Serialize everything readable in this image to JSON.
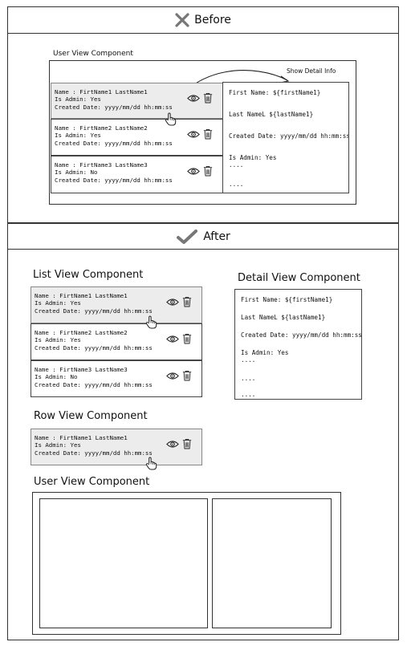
{
  "before": {
    "header": "Before",
    "user_view_label": "User View Component",
    "arrow_label": "Show Detail Info",
    "rows": [
      {
        "name": "Name : FirtName1 LastName1",
        "admin": "Is Admin: Yes",
        "created": "Created Date: yyyy/mm/dd hh:mm:ss"
      },
      {
        "name": "Name : FirtName2 LastName2",
        "admin": "Is Admin: Yes",
        "created": "Created Date: yyyy/mm/dd hh:mm:ss"
      },
      {
        "name": "Name : FirtName3 LastName3",
        "admin": "Is Admin: No",
        "created": "Created Date: yyyy/mm/dd hh:mm:ss"
      }
    ],
    "detail": {
      "first": "First Name: ${firstName1}",
      "last": "Last NameL ${lastName1}",
      "created": "Created Date: yyyy/mm/dd hh:mm:ss",
      "admin": "Is Admin: Yes",
      "e1": "....",
      "e2": "....",
      "e3": "...."
    }
  },
  "after": {
    "header": "After",
    "list_label": "List View Component",
    "detail_label": "Detail View Component",
    "row_label": "Row View Component",
    "user_view_label": "User View Component",
    "rows": [
      {
        "name": "Name : FirtName1 LastName1",
        "admin": "Is Admin: Yes",
        "created": "Created Date: yyyy/mm/dd hh:mm:ss"
      },
      {
        "name": "Name : FirtName2 LastName2",
        "admin": "Is Admin: Yes",
        "created": "Created Date: yyyy/mm/dd hh:mm:ss"
      },
      {
        "name": "Name : FirtName3 LastName3",
        "admin": "Is Admin: No",
        "created": "Created Date: yyyy/mm/dd hh:mm:ss"
      }
    ],
    "row_single": {
      "name": "Name : FirtName1 LastName1",
      "admin": "Is Admin: Yes",
      "created": "Created Date: yyyy/mm/dd hh:mm:ss"
    },
    "detail": {
      "first": "First Name: ${firstName1}",
      "last": "Last NameL ${lastName1}",
      "created": "Created Date: yyyy/mm/dd hh:mm:ss",
      "admin": "Is Admin: Yes",
      "e1": "....",
      "e2": "....",
      "e3": "...."
    }
  },
  "icons": {
    "fail": "x-icon",
    "success": "check-icon",
    "view": "eye-icon",
    "delete": "trash-icon",
    "pointer": "hand-pointer-icon"
  }
}
